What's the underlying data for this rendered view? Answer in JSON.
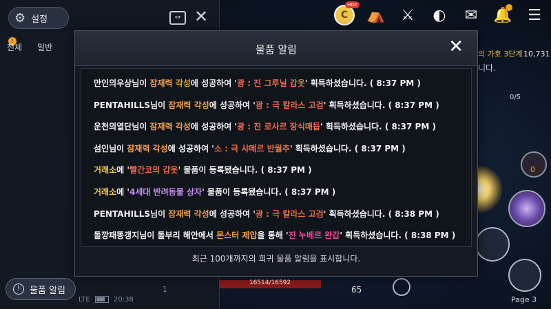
{
  "left_panel": {
    "settings_label": "설정",
    "tabs": [
      "전체",
      "일반"
    ],
    "tab_badge": "!",
    "item_alert_label": "물품 알림",
    "status_text": "LTE",
    "time_text": "20:38",
    "num_1": "1"
  },
  "top_bar": {
    "hot_badge": "HOT",
    "coin_label": "C",
    "title_text": "의 가호 3단계",
    "right_num": "10,731",
    "right_text": "니다.",
    "count": "0/5",
    "orb_count": "0"
  },
  "hud": {
    "hp_text": "16514/16592",
    "level": "65",
    "page_label": "Page 3"
  },
  "modal": {
    "title": "물품 알림",
    "footer": "최근 100개까지의 희귀 물품 알림을 표시합니다.",
    "messages": [
      {
        "player": "만인의우상",
        "mid1": "님이 ",
        "skill": "잠재력 각성",
        "mid2": "에 성공하여 '",
        "item": "광 : 진 그루닐 갑옷",
        "tail": "' 획득하셨습니다. ( 8:37 PM )"
      },
      {
        "player": "PENTAHILLS",
        "mid1": "님이 ",
        "skill": "잠재력 각성",
        "mid2": "에 성공하여 '",
        "item": "광 : 극 칼라스 고검",
        "tail": "' 획득하셨습니다. ( 8:37 PM )"
      },
      {
        "player": "운천의열단",
        "mid1": "님이 ",
        "skill": "잠재력 각성",
        "mid2": "에 성공하여 '",
        "item": "광 : 진 로사르 장식매듭",
        "tail": "' 획득하셨습니다. ( 8:37 PM )"
      },
      {
        "player": "섬인",
        "mid1": "님이 ",
        "skill": "잠재력 각성",
        "mid2": "에 성공하여 '",
        "item": "소 : 극 샤메르 반월추",
        "tail": "' 획득하셨습니다. ( 8:37 PM )"
      },
      {
        "player": "거래소",
        "mid1": "에 '",
        "item": "빨간코의 갑옷",
        "tail": "' 물품이 등록됐습니다. ( 8:37 PM )"
      },
      {
        "player": "거래소",
        "mid1": "에 '",
        "item": "4세대 반려동물 상자",
        "tail": "' 물품이 등록됐습니다. ( 8:37 PM )"
      },
      {
        "player": "PENTAHILLS",
        "mid1": "님이 ",
        "skill": "잠재력 각성",
        "mid2": "에 성공하여 '",
        "item": "광 : 극 칼라스 고검",
        "tail": "' 획득하셨습니다. ( 8:38 PM )"
      },
      {
        "player": "돌깡패똥갱지",
        "mid1": "님이 돌부리 해안에서 ",
        "skill": "몬스터 제압",
        "mid2": "을 통해 '",
        "item": "진 누베르 완갑",
        "tail": "' 획득하셨습니다. ( 8:38 PM )"
      }
    ]
  },
  "colors": {
    "skill": "#f0a04b",
    "exchange": "#f2c84b",
    "item_red": "#f06a4a",
    "item_purple": "#c88cf0",
    "item_magenta": "#e34a9a"
  }
}
